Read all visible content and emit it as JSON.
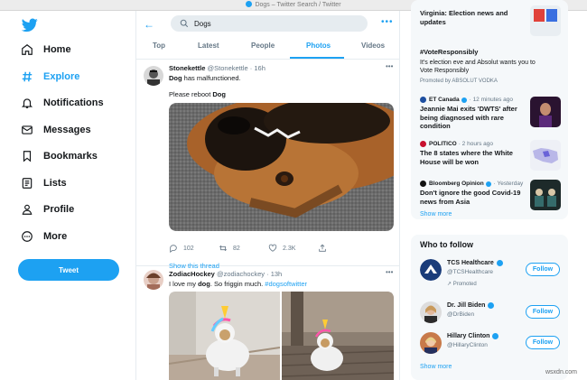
{
  "window": {
    "title": "Dogs – Twitter Search / Twitter"
  },
  "sidebar": {
    "items": [
      {
        "label": "Home",
        "icon": "home-icon"
      },
      {
        "label": "Explore",
        "icon": "hashtag-icon",
        "active": true
      },
      {
        "label": "Notifications",
        "icon": "bell-icon"
      },
      {
        "label": "Messages",
        "icon": "envelope-icon"
      },
      {
        "label": "Bookmarks",
        "icon": "bookmark-icon"
      },
      {
        "label": "Lists",
        "icon": "list-icon"
      },
      {
        "label": "Profile",
        "icon": "person-icon"
      },
      {
        "label": "More",
        "icon": "more-circle-icon"
      }
    ],
    "tweet_button": "Tweet"
  },
  "main": {
    "search_value": "Dogs",
    "tabs": [
      {
        "label": "Top"
      },
      {
        "label": "Latest"
      },
      {
        "label": "People"
      },
      {
        "label": "Photos",
        "active": true
      },
      {
        "label": "Videos"
      }
    ],
    "tweets": [
      {
        "name": "Stonekettle",
        "handle": "@Stonekettle",
        "time": "16h",
        "line1_bold": "Dog",
        "line1_rest": " has malfunctioned.",
        "line2_plain": "Please reboot ",
        "line2_bold": "Dog",
        "replies": "102",
        "retweets": "82",
        "likes": "2.3K",
        "show_thread": "Show this thread"
      },
      {
        "name": "ZodiacHockey",
        "handle": "@zodiachockey",
        "time": "13h",
        "text_plain": "I love my ",
        "text_bold": "dog",
        "text_rest": ". So friggin much. ",
        "hashtag": "#dogsoftwitter"
      }
    ]
  },
  "right": {
    "trend_top": {
      "line1": "Virginia: Election news and",
      "line2": "updates"
    },
    "promo": {
      "title": "#VoteResponsibly",
      "desc1": "It's election eve and Absolut wants you to",
      "desc2": "Vote Responsibly",
      "by": "Promoted by ABSOLUT VODKA"
    },
    "news": [
      {
        "source": "ET Canada",
        "time": "· 12 minutes ago",
        "headline": "Jeannie Mai exits 'DWTS' after being diagnosed with rare condition",
        "logo_color": "#1e4fa0"
      },
      {
        "source": "POLITICO",
        "time": "· 2 hours ago",
        "headline": "The 8 states where the White House will be won",
        "logo_color": "#c8102e"
      },
      {
        "source": "Bloomberg Opinion",
        "time": "· Yesterday",
        "headline": "Don't ignore the good Covid-19 news from Asia",
        "logo_color": "#111111"
      }
    ],
    "show_more_1": "Show more",
    "who_to_follow": {
      "title": "Who to follow",
      "follow_label": "Follow",
      "people": [
        {
          "name": "TCS Healthcare",
          "handle": "@TCSHealthcare",
          "promoted": "Promoted"
        },
        {
          "name": "Dr. Jill Biden",
          "handle": "@DrBiden"
        },
        {
          "name": "Hillary Clinton",
          "handle": "@HillaryClinton"
        }
      ],
      "show_more": "Show more"
    }
  },
  "watermark": "wsxdn.com",
  "colors": {
    "accent": "#1da1f2",
    "text": "#14171a",
    "muted": "#657786"
  }
}
